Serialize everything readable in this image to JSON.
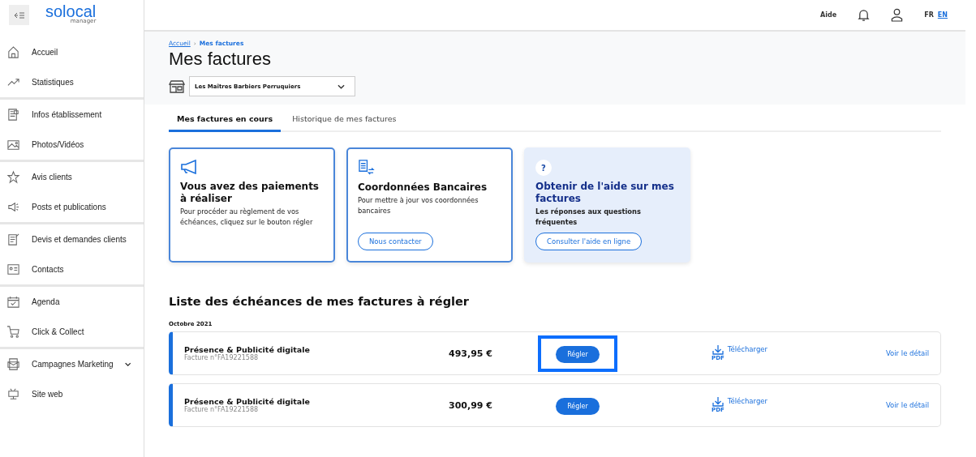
{
  "sidebar": {
    "logo": "solocal",
    "logo_sub": "manager",
    "groups": [
      {
        "items": [
          {
            "label": "Accueil"
          },
          {
            "label": "Statistiques"
          }
        ]
      },
      {
        "items": [
          {
            "label": "Infos établissement"
          },
          {
            "label": "Photos/Vidéos"
          }
        ]
      },
      {
        "items": [
          {
            "label": "Avis clients"
          },
          {
            "label": "Posts et publications"
          }
        ]
      },
      {
        "items": [
          {
            "label": "Devis et demandes clients"
          },
          {
            "label": "Contacts"
          }
        ]
      },
      {
        "items": [
          {
            "label": "Agenda"
          },
          {
            "label": "Click & Collect"
          }
        ]
      },
      {
        "items": [
          {
            "label": "Campagnes Marketing",
            "expandable": true
          },
          {
            "label": "Site web"
          }
        ]
      }
    ]
  },
  "topbar": {
    "help": "Aide",
    "languages": [
      {
        "label": "FR",
        "selected": true
      },
      {
        "label": "EN",
        "selected": false
      }
    ]
  },
  "breadcrumb": [
    {
      "label": "Accueil"
    },
    {
      "label": "Mes factures"
    }
  ],
  "breadcrumb_separator": "›",
  "title": "Mes factures",
  "business_select": {
    "value": "Les Maîtres Barbiers Perruquiers"
  },
  "tabs": [
    {
      "label": "Mes factures en cours",
      "selected": true
    },
    {
      "label": "Historique de mes factures",
      "selected": false
    }
  ],
  "cards": [
    {
      "kind": "payment",
      "title": "Vous avez des paiements à réaliser",
      "text": "Pour procéder au règlement de vos échéances, cliquez sur le bouton régler"
    },
    {
      "kind": "bank",
      "title": "Coordonnées Bancaires",
      "text": "Pour mettre à jour vos coordonnées bancaires",
      "button": "Nous contacter"
    },
    {
      "kind": "help",
      "icon": "?",
      "title": "Obtenir de l'aide sur mes factures",
      "text": "Les réponses aux questions fréquentes",
      "button": "Consulter l'aide en ligne"
    }
  ],
  "section_title": "Liste des échéances de mes factures à régler",
  "month": "Octobre 2021",
  "invoices": [
    {
      "title": "Présence & Publicité digitale",
      "number": "Facture n°FA19221588",
      "amount": "493,95 €",
      "pay": "Régler",
      "focused": true,
      "pdf": "PDF",
      "download": "Télécharger",
      "detail": "Voir le détail"
    },
    {
      "title": "Présence & Publicité digitale",
      "number": "Facture n°FA19221588",
      "amount": "300,99 €",
      "pay": "Régler",
      "focused": false,
      "pdf": "PDF",
      "download": "Télécharger",
      "detail": "Voir le détail"
    }
  ]
}
